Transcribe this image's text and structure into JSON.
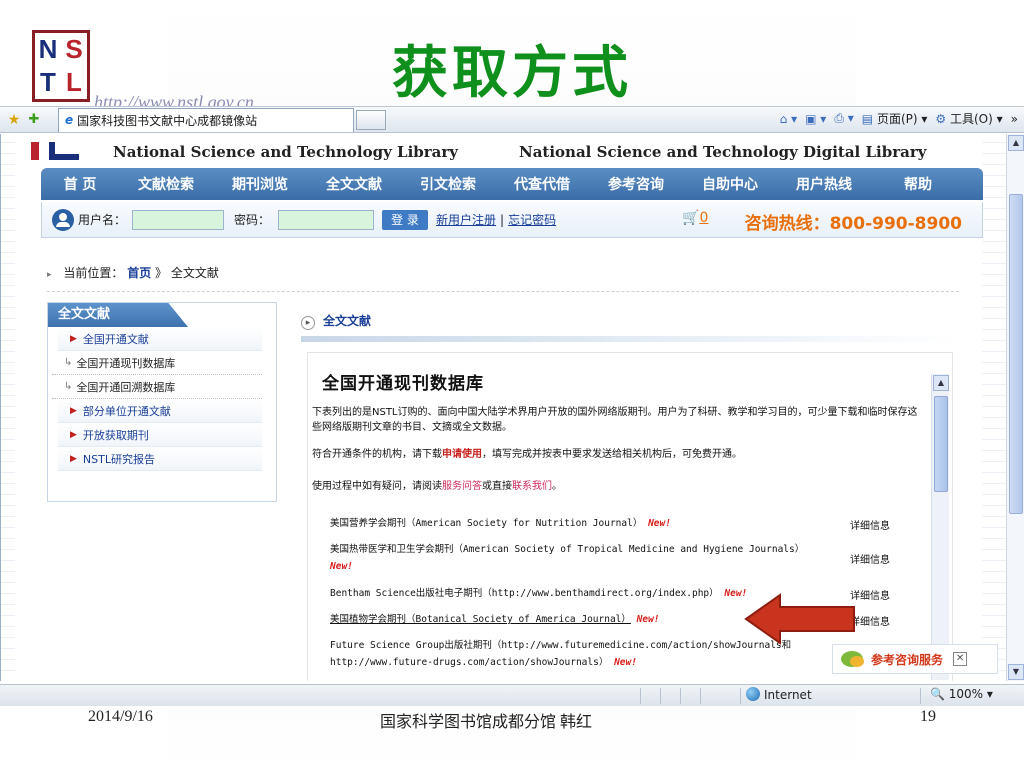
{
  "slide": {
    "title": "获取方式",
    "logo_letters": [
      "N",
      "S",
      "T",
      "L"
    ],
    "url_text": "http://www.nstl.gov.cn",
    "footer_date": "2014/9/16",
    "footer_center": "国家科学图书馆成都分馆  韩红",
    "footer_page": "19"
  },
  "browser": {
    "tab_title": "国家科技图书文献中心成都镜像站",
    "cmd_page": "页面(P)",
    "cmd_tools": "工具(O)",
    "status_zone": "Internet",
    "status_zoom": "100%"
  },
  "site": {
    "lib_name_en": "National Science and Technology Library",
    "lib_name_en2": "National Science and Technology Digital Library",
    "nav": [
      "首  页",
      "文献检索",
      "期刊浏览",
      "全文文献",
      "引文检索",
      "代查代借",
      "参考咨询",
      "自助中心",
      "用户热线",
      "帮助"
    ],
    "login": {
      "username_label": "用户名：",
      "password_label": "密码：",
      "login_button": "登  录",
      "register_link": "新用户注册",
      "sep": "|",
      "forgot_link": "忘记密码",
      "cart_count": "0",
      "hotline": "咨询热线：800-990-8900"
    },
    "breadcrumb": {
      "prefix": "当前位置：",
      "home": "首页",
      "sep": "》",
      "current": "全文文献"
    },
    "sidebar": {
      "title": "全文文献",
      "items": [
        {
          "label": "全国开通文献",
          "style": "boxed"
        },
        {
          "label": "全国开通现刊数据库",
          "style": "plain"
        },
        {
          "label": "全国开通回溯数据库",
          "style": "plain"
        },
        {
          "label": "部分单位开通文献",
          "style": "boxed"
        },
        {
          "label": "开放获取期刊",
          "style": "boxed"
        },
        {
          "label": "NSTL研究报告",
          "style": "boxed"
        }
      ]
    },
    "content": {
      "section_title": "全文文献",
      "heading": "全国开通现刊数据库",
      "para1": "下表列出的是NSTL订购的、面向中国大陆学术界用户开放的国外网络版期刊。用户为了科研、教学和学习目的，可少量下载和临时保存这些网络版期刊文章的书目、文摘或全文数据。",
      "para2_a": "符合开通条件的机构，请下载",
      "para2_link": "申请使用",
      "para2_b": "，填写完成并按表中要求发送给相关机构后，可免费开通。",
      "para3_a": "使用过程中如有疑问，请阅读",
      "para3_link1": "服务问答",
      "para3_mid": "或直接",
      "para3_link2": "联系我们",
      "para3_end": "。",
      "new_tag": "New!",
      "detail_label": "详细信息",
      "journals": [
        "美国营养学会期刊（American Society for Nutrition Journal）",
        "美国热带医学和卫生学会期刊（American Society of Tropical Medicine and Hygiene Journals）",
        "Bentham Science出版社电子期刊（http://www.benthamdirect.org/index.php）",
        "美国植物学会期刊（Botanical Society of America Journal）",
        "Future Science Group出版社期刊（http://www.futuremedicine.com/action/showJournals和http://www.future-drugs.com/action/showJournals）"
      ]
    },
    "consult_widget": "参考咨询服务"
  }
}
